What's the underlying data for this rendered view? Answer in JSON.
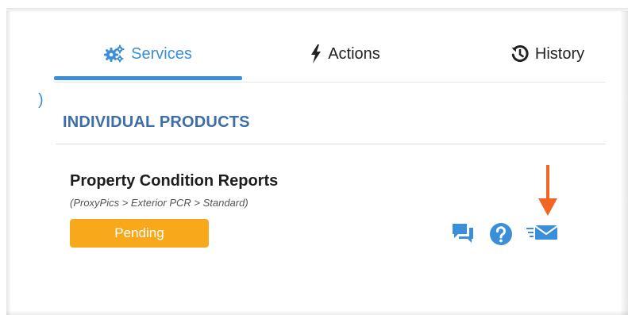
{
  "tabs": {
    "services_label": "Services",
    "actions_label": "Actions",
    "history_label": "History",
    "active": "Services"
  },
  "stray_glyph": ")",
  "section": {
    "title": "INDIVIDUAL PRODUCTS"
  },
  "product": {
    "title": "Property Condition Reports",
    "path": "(ProxyPics > Exterior PCR > Standard)",
    "status": "Pending"
  },
  "icons": {
    "services": "gears-icon",
    "actions": "bolt-icon",
    "history": "history-icon",
    "chat": "chat-icon",
    "help": "help-icon",
    "send": "send-mail-icon",
    "annotation": "arrow-down-icon"
  },
  "colors": {
    "accent": "#3a8fd8",
    "section_title": "#3d6ea8",
    "status_pending": "#f7a81b",
    "annotation_arrow": "#f26522"
  }
}
